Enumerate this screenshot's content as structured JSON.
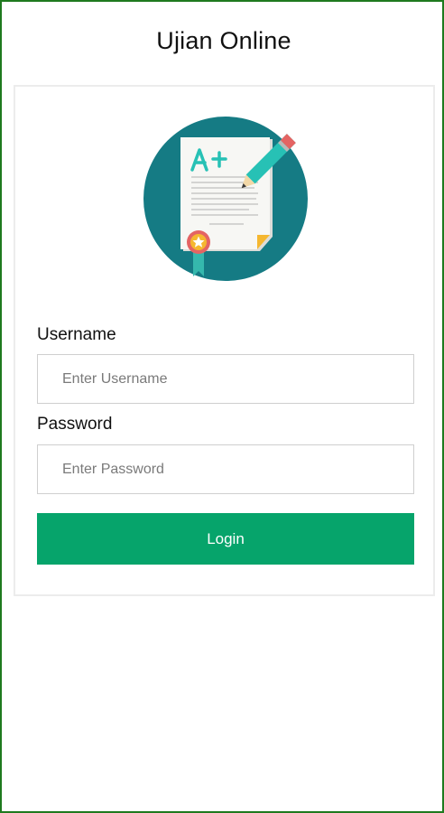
{
  "app": {
    "title": "Ujian Online"
  },
  "illustration": {
    "icon": "exam-paper-icon",
    "grade_text": "A+",
    "colors": {
      "circle": "#157b84",
      "paper": "#f7f7f4",
      "grade": "#27c1b5",
      "pencil": "#e46463",
      "fold": "#f5b730",
      "ribbon": "#35b8ad"
    }
  },
  "login_form": {
    "username_label": "Username",
    "username_placeholder": "Enter Username",
    "username_value": "",
    "password_label": "Password",
    "password_placeholder": "Enter Password",
    "password_value": "",
    "login_button_label": "Login"
  },
  "colors": {
    "frame_border": "#1f7a1f",
    "button": "#06a46b",
    "button_text": "#ffffff",
    "input_border": "#cfcfcf"
  }
}
